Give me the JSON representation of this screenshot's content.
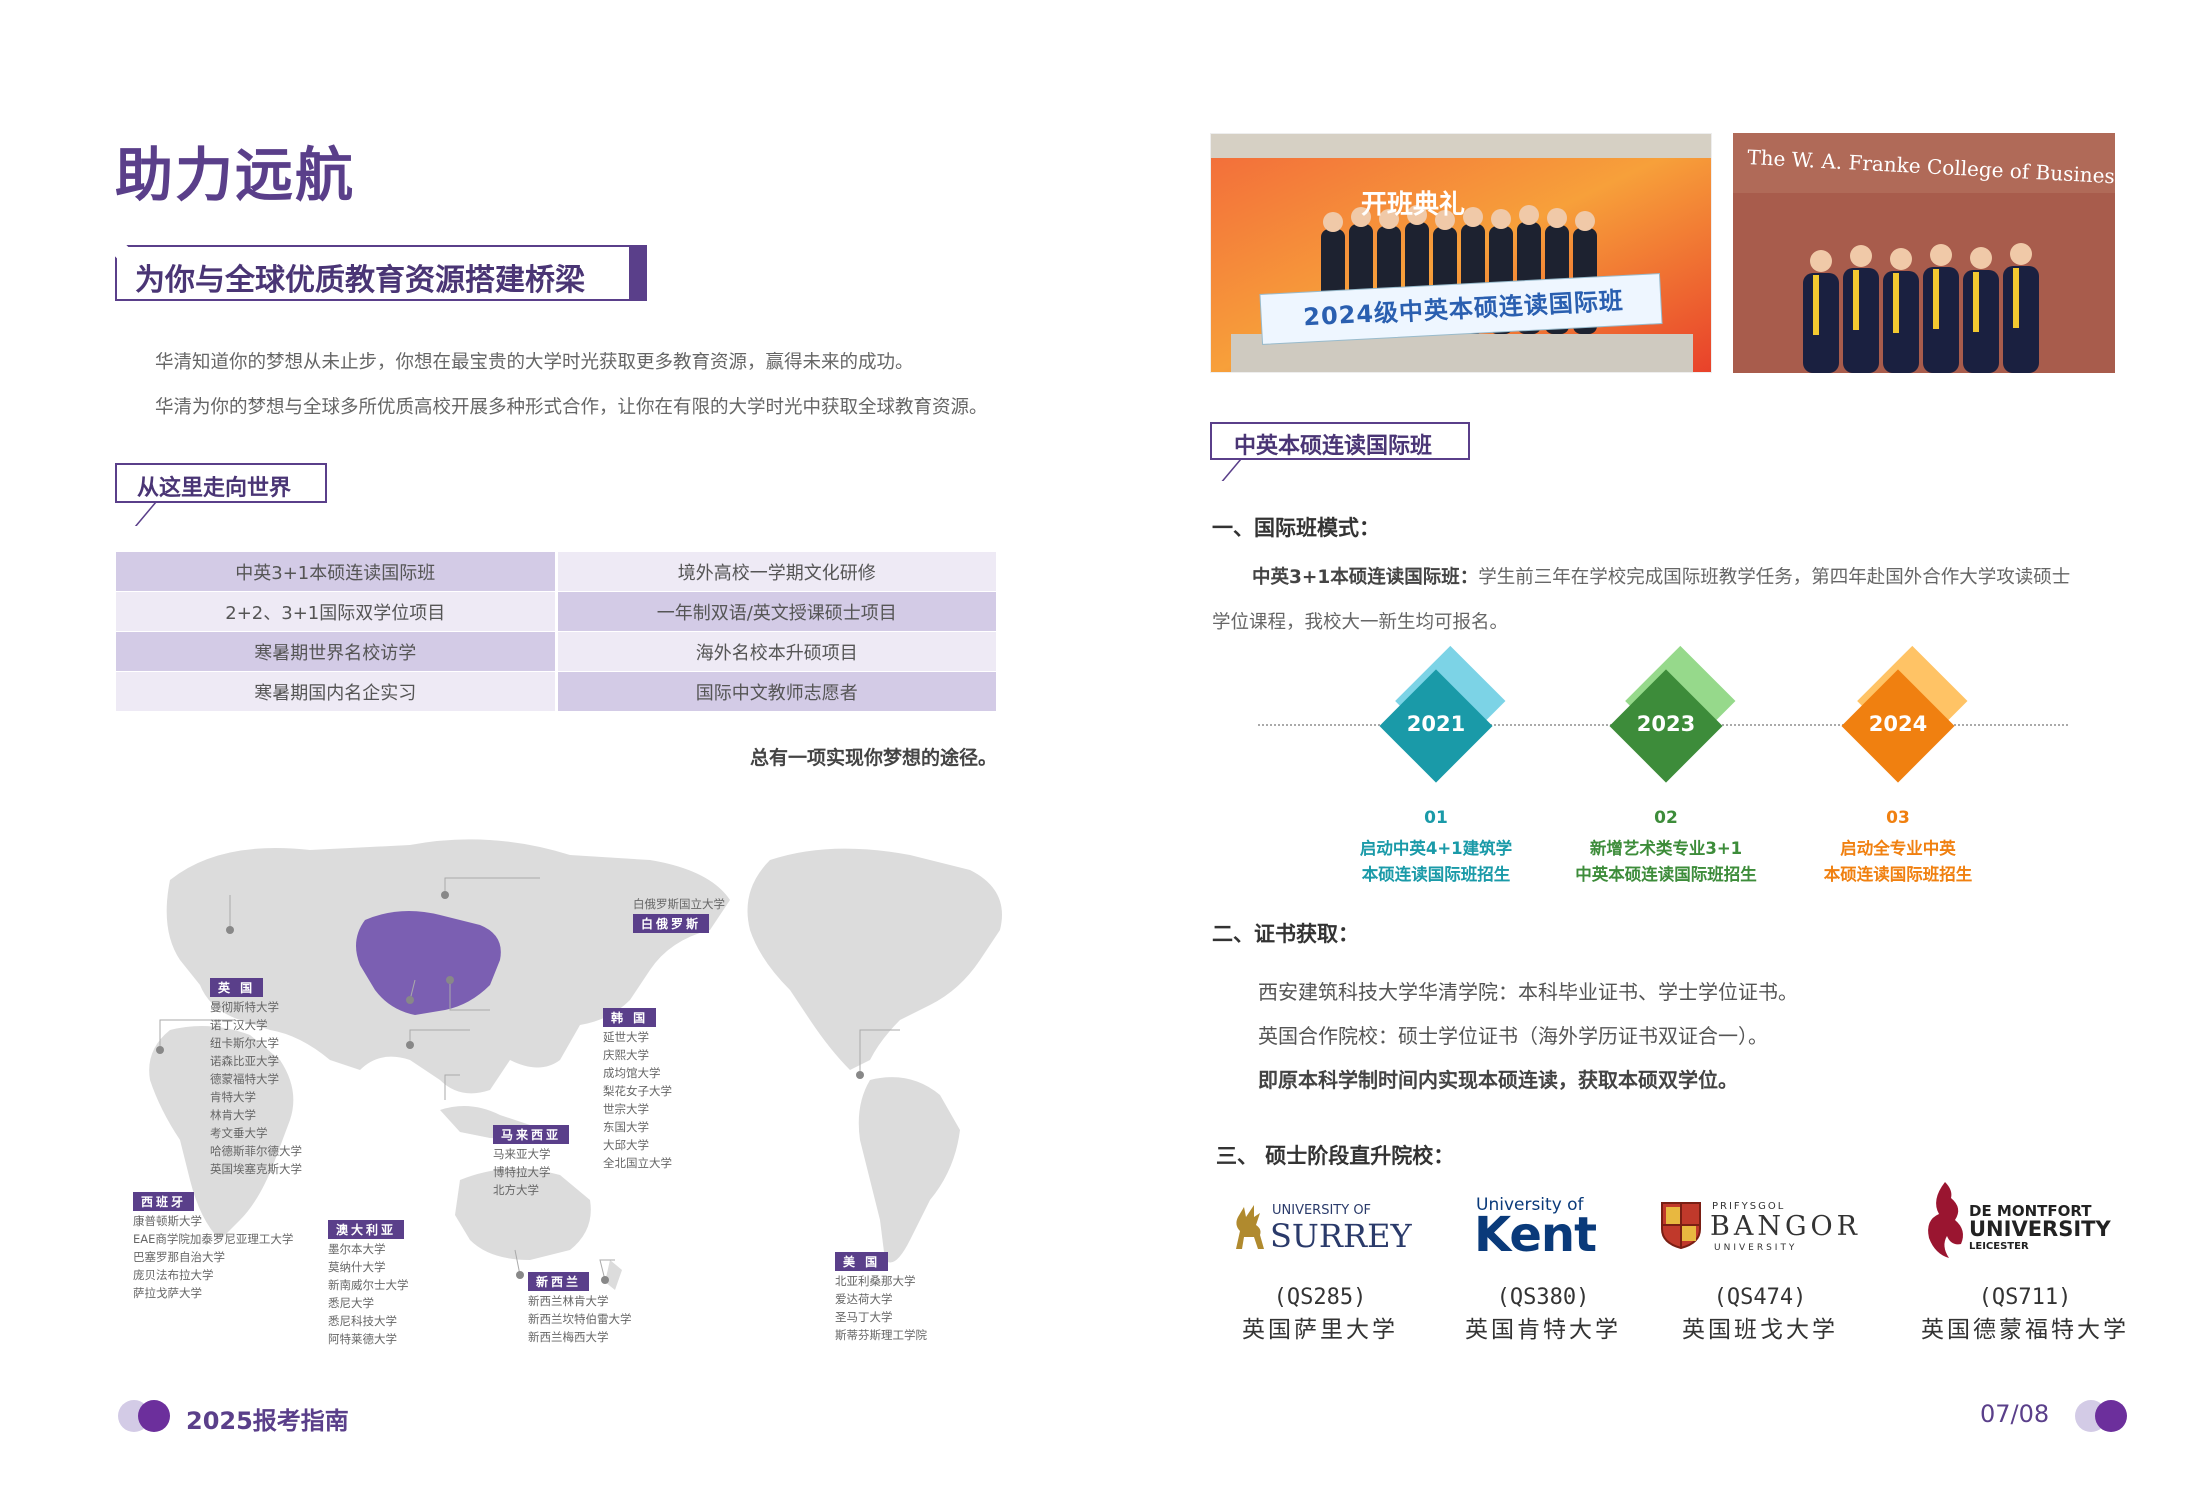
{
  "left": {
    "title": "助力远航",
    "banner": "为你与全球优质教育资源搭建桥梁",
    "paragraphs": [
      "华清知道你的梦想从未止步，你想在最宝贵的大学时光获取更多教育资源，赢得未来的成功。",
      "华清为你的梦想与全球多所优质高校开展多种形式合作，让你在有限的大学时光中获取全球教育资源。"
    ],
    "subtitle": "从这里走向世界",
    "grid": [
      [
        "中英3+1本硕连读国际班",
        "境外高校一学期文化研修"
      ],
      [
        "2+2、3+1国际双学位项目",
        "一年制双语/英文授课硕士项目"
      ],
      [
        "寒暑期世界名校访学",
        "海外名校本升硕项目"
      ],
      [
        "寒暑期国内名企实习",
        "国际中文教师志愿者"
      ]
    ],
    "slogan": "总有一项实现你梦想的途径。",
    "map": {
      "belarus": {
        "tag": "白俄罗斯",
        "unis": [
          "白俄罗斯国立大学"
        ]
      },
      "uk": {
        "tag": "英 国",
        "unis": [
          "曼彻斯特大学",
          "诺丁汉大学",
          "纽卡斯尔大学",
          "诺森比亚大学",
          "德蒙福特大学",
          "肯特大学",
          "林肯大学",
          "考文垂大学",
          "哈德斯菲尔德大学",
          "英国埃塞克斯大学"
        ]
      },
      "korea": {
        "tag": "韩 国",
        "unis": [
          "延世大学",
          "庆熙大学",
          "成均馆大学",
          "梨花女子大学",
          "世宗大学",
          "东国大学",
          "大邱大学",
          "全北国立大学"
        ]
      },
      "malaysia": {
        "tag": "马来西亚",
        "unis": [
          "马来亚大学",
          "博特拉大学",
          "北方大学"
        ]
      },
      "spain": {
        "tag": "西班牙",
        "unis": [
          "康普顿斯大学",
          "EAE商学院加泰罗尼亚理工大学",
          "巴塞罗那自治大学",
          "庞贝法布拉大学",
          "萨拉戈萨大学"
        ]
      },
      "australia": {
        "tag": "澳大利亚",
        "unis": [
          "墨尔本大学",
          "莫纳什大学",
          "新南威尔士大学",
          "悉尼大学",
          "悉尼科技大学",
          "阿特莱德大学"
        ]
      },
      "nz": {
        "tag": "新西兰",
        "unis": [
          "新西兰林肯大学",
          "新西兰坎特伯雷大学",
          "新西兰梅西大学"
        ]
      },
      "usa": {
        "tag": "美 国",
        "unis": [
          "北亚利桑那大学",
          "爱达荷大学",
          "圣马丁大学",
          "斯蒂芬斯理工学院"
        ]
      }
    },
    "footer": "2025报考指南"
  },
  "right": {
    "photo1": {
      "top_text": "开班典礼",
      "banner_text": "2024级中英本硕连读国际班"
    },
    "photo2": {
      "sign": "The W. A. Franke College of Business"
    },
    "subtitle": "中英本硕连读国际班",
    "section1": "一、国际班模式：",
    "mode_bold": "中英3+1本硕连读国际班：",
    "mode_text": "学生前三年在学校完成国际班教学任务，第四年赴国外合作大学攻读硕士",
    "mode_text2": "学位课程，我校大一新生均可报名。",
    "timeline": [
      {
        "year": "2021",
        "num": "01",
        "line1": "启动中英4+1建筑学",
        "line2": "本硕连读国际班招生",
        "color": "#1a9aa8",
        "color2": "#5bc8e0"
      },
      {
        "year": "2023",
        "num": "02",
        "line1": "新增艺术类专业3+1",
        "line2": "中英本硕连读国际班招生",
        "color": "#3d8c3a",
        "color2": "#7ccf6e"
      },
      {
        "year": "2024",
        "num": "03",
        "line1": "启动全专业中英",
        "line2": "本硕连读国际班招生",
        "color": "#f08010",
        "color2": "#ffb84a"
      }
    ],
    "section2": "二、证书获取：",
    "cert": [
      "西安建筑科技大学华清学院：本科毕业证书、学士学位证书。",
      "英国合作院校：硕士学位证书（海外学历证书双证合一）。"
    ],
    "cert_bold": "即原本科学制时间内实现本硕连读，获取本硕双学位。",
    "section3": "三、 硕士阶段直升院校：",
    "unis": [
      {
        "logo_top": "UNIVERSITY OF",
        "logo_main": "SURREY",
        "qs": "(QS285)",
        "name": "英国萨里大学"
      },
      {
        "logo_top": "University of",
        "logo_main": "Kent",
        "qs": "(QS380)",
        "name": "英国肯特大学"
      },
      {
        "logo_top": "PRIFYSGOL",
        "logo_main": "BANGOR",
        "logo_sub": "UNIVERSITY",
        "qs": "(QS474)",
        "name": "英国班戈大学"
      },
      {
        "logo_top": "DE MONTFORT",
        "logo_main": "UNIVERSITY",
        "logo_sub": "LEICESTER",
        "qs": "(QS711)",
        "name": "英国德蒙福特大学"
      }
    ],
    "page": "07/08"
  },
  "colors": {
    "primary": "#5a3f8a",
    "grid_dark": "#d3cbe6",
    "grid_light": "#eeeaf5"
  }
}
